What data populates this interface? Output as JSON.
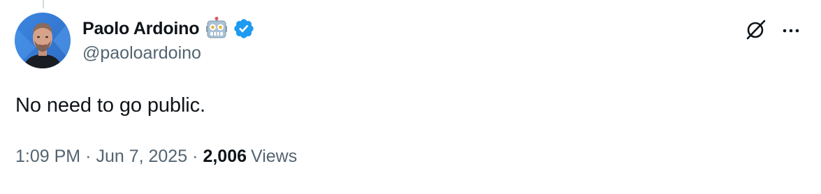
{
  "tweet": {
    "author": {
      "display_name": "Paolo Ardoino",
      "handle": "@paoloardoino",
      "name_emoji": "robot-face-icon",
      "verified": true,
      "verified_color": "#1d9bf0"
    },
    "text": "No need to go public.",
    "meta": {
      "time": "1:09 PM",
      "separator": "·",
      "date": "Jun 7, 2025",
      "views_count": "2,006",
      "views_label": "Views"
    },
    "actions": {
      "grok_icon": "grok-icon",
      "more_icon": "more-options-icon"
    }
  },
  "colors": {
    "text_primary": "#0f1419",
    "text_secondary": "#536471",
    "thread_line": "#cfd9de"
  }
}
